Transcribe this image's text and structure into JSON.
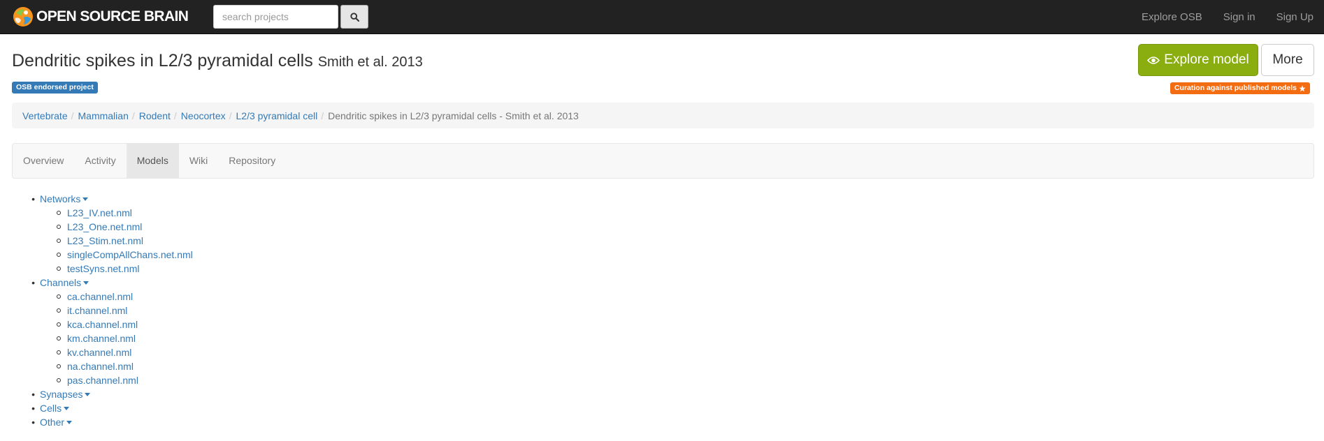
{
  "navbar": {
    "brand": "OPEN SOURCE BRAIN",
    "search_placeholder": "search projects",
    "links": [
      "Explore OSB",
      "Sign in",
      "Sign Up"
    ]
  },
  "header": {
    "title": "Dendritic spikes in L2/3 pyramidal cells",
    "subtitle": "Smith et al. 2013",
    "endorsed_badge": "OSB endorsed project",
    "explore_button": "Explore model",
    "more_button": "More",
    "curation_badge": "Curation against published models"
  },
  "breadcrumb": {
    "items": [
      "Vertebrate",
      "Mammalian",
      "Rodent",
      "Neocortex",
      "L2/3 pyramidal cell"
    ],
    "current": "Dendritic spikes in L2/3 pyramidal cells - Smith et al. 2013"
  },
  "tabs": {
    "items": [
      "Overview",
      "Activity",
      "Models",
      "Wiki",
      "Repository"
    ],
    "active": "Models"
  },
  "models": {
    "groups": [
      {
        "label": "Networks",
        "files": [
          "L23_IV.net.nml",
          "L23_One.net.nml",
          "L23_Stim.net.nml",
          "singleCompAllChans.net.nml",
          "testSyns.net.nml"
        ]
      },
      {
        "label": "Channels",
        "files": [
          "ca.channel.nml",
          "it.channel.nml",
          "kca.channel.nml",
          "km.channel.nml",
          "kv.channel.nml",
          "na.channel.nml",
          "pas.channel.nml"
        ]
      },
      {
        "label": "Synapses",
        "files": []
      },
      {
        "label": "Cells",
        "files": []
      },
      {
        "label": "Other",
        "files": []
      }
    ]
  },
  "colors": {
    "navbar_bg": "#222222",
    "link": "#337ab7",
    "explore_button": "#8aad0f",
    "endorsed_badge": "#337ab7",
    "curation_badge": "#f36c12"
  },
  "icons": {
    "brand": "osb-logo-icon",
    "search": "search-icon",
    "explore": "eye-icon",
    "curation": "star-icon",
    "group_toggle": "caret-down-icon"
  }
}
